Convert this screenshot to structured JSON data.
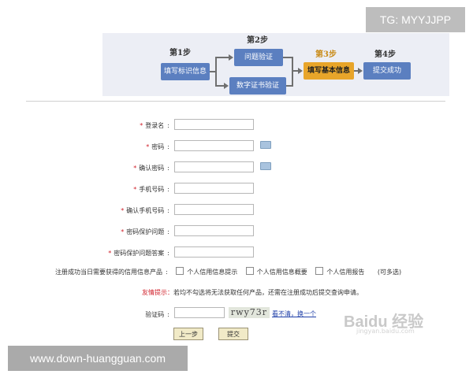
{
  "watermark_top": "TG: MYYJJPP",
  "watermark_bottom": "www.down-huangguan.com",
  "baidu_mark": "Baidu 经验",
  "baidu_url": "jingyan.baidu.com",
  "steps": {
    "step1_label": "第1步",
    "step1_box": "填写标识信息",
    "step2_label": "第2步",
    "step2_box_a": "问题验证",
    "step2_box_b": "数字证书验证",
    "step3_label": "第3步",
    "step3_box": "填写基本信息",
    "step4_label": "第4步",
    "step4_box": "提交成功"
  },
  "form": {
    "login_name": "登录名",
    "password": "密码",
    "confirm_password": "确认密码",
    "phone": "手机号码",
    "confirm_phone": "确认手机号码",
    "security_question": "密码保护问题",
    "security_answer": "密码保护问题答案",
    "products_label": "注册成功当日需要获得的信用信息产品",
    "product1": "个人信用信息提示",
    "product2": "个人信用信息概要",
    "product3": "个人信用报告",
    "multi_select": "(可多选)",
    "tip_label": "友情提示",
    "tip_text": "若均不勾选将无法获取任何产品，还需在注册成功后提交查询申请。",
    "captcha_label": "验证码",
    "captcha_text": "rwy73r",
    "refresh_link": "看不清，换一个",
    "prev_button": "上一步",
    "submit_button": "提交"
  },
  "colors": {
    "required_star": "#d0212b",
    "step_blue": "#5b7fc0",
    "step_active": "#e8a52a"
  }
}
